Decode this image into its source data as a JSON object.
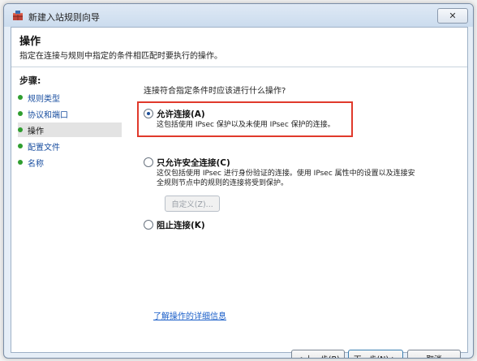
{
  "window": {
    "title": "新建入站规则向导",
    "close_label": "✕"
  },
  "header": {
    "title": "操作",
    "description": "指定在连接与规则中指定的条件相匹配时要执行的操作。"
  },
  "sidebar": {
    "steps_title": "步骤:",
    "items": [
      {
        "label": "规则类型",
        "active": false
      },
      {
        "label": "协议和端口",
        "active": false
      },
      {
        "label": "操作",
        "active": true
      },
      {
        "label": "配置文件",
        "active": false
      },
      {
        "label": "名称",
        "active": false
      }
    ]
  },
  "main": {
    "question": "连接符合指定条件时应该进行什么操作?",
    "options": [
      {
        "label": "允许连接(A)",
        "description": [
          "这包括使用 IPsec 保护以及未使用 IPsec 保护的连接。"
        ],
        "checked": true
      },
      {
        "label": "只允许安全连接(C)",
        "description": [
          "这仅包括使用 IPsec 进行身份验证的连接。使用 IPsec 属性中的设置以及连接安",
          "全规则节点中的规则的连接将受到保护。"
        ],
        "checked": false
      },
      {
        "label": "阻止连接(K)",
        "description": [],
        "checked": false
      }
    ],
    "custom_button": "自定义(Z)...",
    "learn_more": "了解操作的详细信息"
  },
  "footer": {
    "back_button": "< 上一步(B)",
    "next_button": "下一步(N) >",
    "cancel_button": "取消"
  },
  "colors": {
    "highlight_border": "#e0392b",
    "link": "#1a5ec8",
    "step_dot": "#2f9e2f"
  }
}
